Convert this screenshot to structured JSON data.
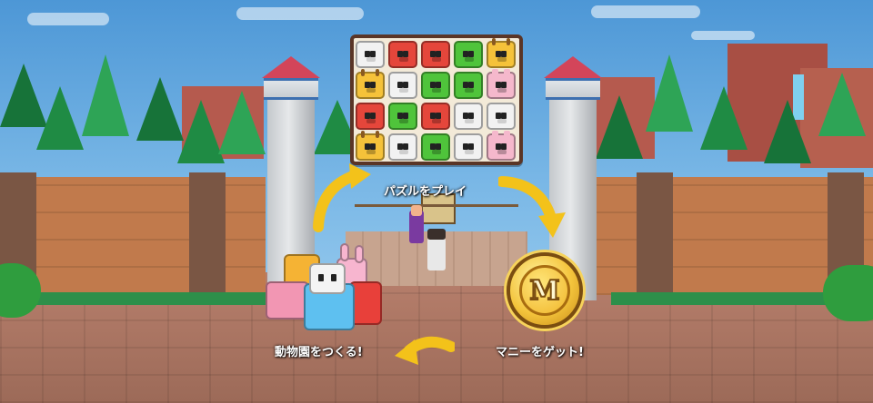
{
  "tutorial": {
    "step_play_puzzle": "パズルをプレイ",
    "step_get_money": "マニーをゲット!",
    "step_build_zoo": "動物園をつくる!"
  },
  "coin": {
    "letter": "M",
    "color": "#f4c43c"
  },
  "puzzle_board": {
    "rows": [
      [
        "panda",
        "monkey",
        "monkey",
        "frog",
        "giraffe"
      ],
      [
        "giraffe",
        "panda",
        "frog",
        "frog",
        "rabbit"
      ],
      [
        "monkey",
        "frog",
        "monkey",
        "panda",
        "panda"
      ],
      [
        "giraffe",
        "panda",
        "frog",
        "panda",
        "rabbit"
      ]
    ],
    "tile_colors": {
      "panda": "#f2f2f2",
      "monkey": "#e5463b",
      "frog": "#4fc43b",
      "giraffe": "#f5c23a",
      "rabbit": "#f5b8cc"
    }
  },
  "icons": [
    "arrow-up-right-icon",
    "arrow-down-right-icon",
    "arrow-left-icon",
    "money-coin-icon"
  ]
}
